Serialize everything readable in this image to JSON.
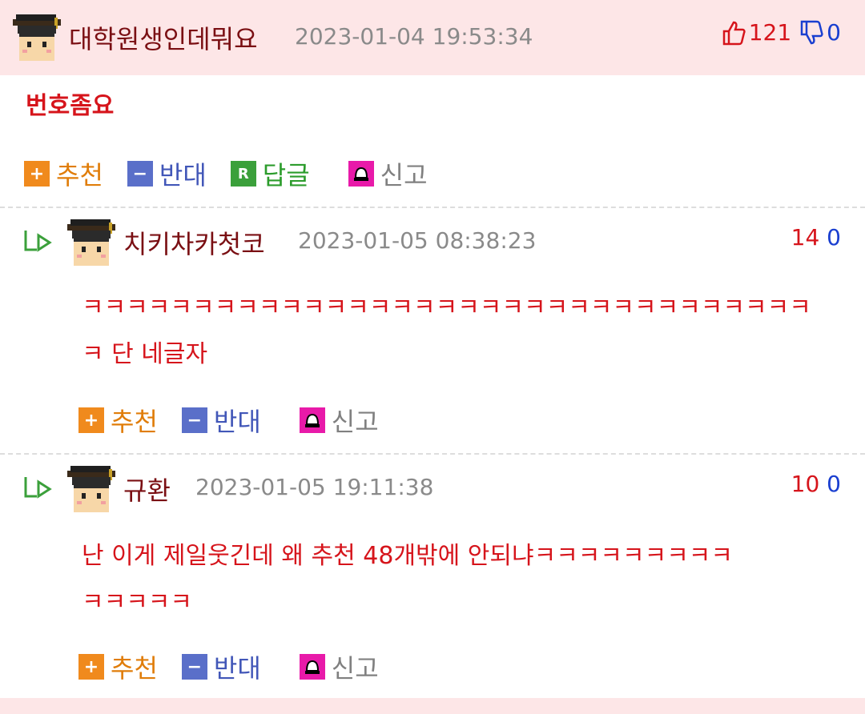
{
  "comments": [
    {
      "nickname": "대학원생인데뭐요",
      "date": "2023-01-04 19:53:34",
      "up": "121",
      "down": "0",
      "text": "번호좀요",
      "actions": {
        "recommend": "추천",
        "oppose": "반대",
        "reply": "답글",
        "report": "신고"
      }
    },
    {
      "nickname": "치키차카첫코",
      "date": "2023-01-05 08:38:23",
      "up": "14",
      "down": "0",
      "text_line1": "ㅋㅋㅋㅋㅋㅋㅋㅋㅋㅋㅋㅋㅋㅋㅋㅋㅋㅋㅋㅋㅋㅋㅋㅋㅋㅋㅋㅋㅋㅋㅋㅋㅋ",
      "text_line2": "ㅋ 단 네글자",
      "actions": {
        "recommend": "추천",
        "oppose": "반대",
        "report": "신고"
      }
    },
    {
      "nickname": "규환",
      "date": "2023-01-05 19:11:38",
      "up": "10",
      "down": "0",
      "text_line1": "난 이게 제일웃긴데 왜 추천 48개밖에 안되냐ㅋㅋㅋㅋㅋㅋㅋㅋㅋ",
      "text_line2": "ㅋㅋㅋㅋㅋ",
      "actions": {
        "recommend": "추천",
        "oppose": "반대",
        "report": "신고"
      }
    }
  ],
  "icons": {
    "avatar": "student-avatar-icon",
    "thumbs_up": "thumbs-up-icon",
    "thumbs_down": "thumbs-down-icon",
    "reply_arrow": "reply-arrow-icon",
    "recommend": "plus-icon",
    "oppose": "minus-icon",
    "reply": "reply-r-icon",
    "report": "siren-icon"
  },
  "colors": {
    "header_bg": "#fde6e7",
    "nickname": "#7a0f13",
    "content": "#d6141b",
    "up": "#d6141b",
    "down": "#1a3fd0",
    "recommend": "#e07d0a",
    "oppose": "#4257b8",
    "reply": "#2c9c2c",
    "report_bg": "#e81aa9"
  }
}
